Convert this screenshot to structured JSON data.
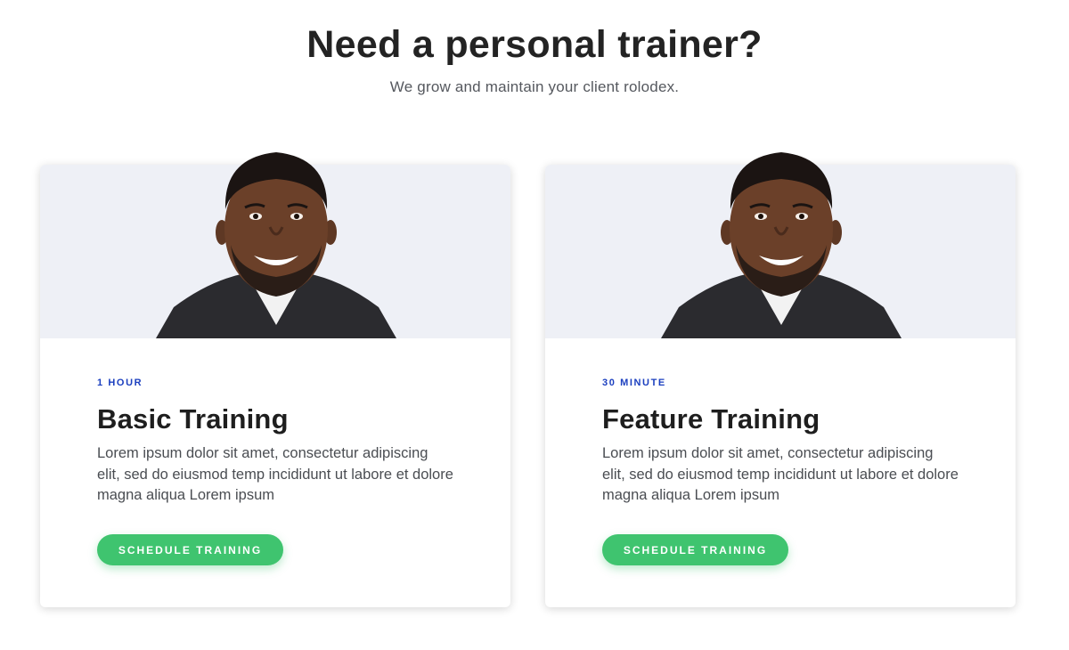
{
  "header": {
    "title": "Need a personal trainer?",
    "subtitle": "We grow and maintain your client rolodex."
  },
  "cards": [
    {
      "duration": "1 HOUR",
      "title": "Basic Training",
      "description": "Lorem ipsum dolor sit amet, consectetur adipiscing elit, sed do eiusmod temp incididunt ut labore et dolore magna aliqua Lorem ipsum",
      "button_label": "SCHEDULE TRAINING",
      "image_alt": "Smiling trainer portrait"
    },
    {
      "duration": "30 MINUTE",
      "title": "Feature Training",
      "description": "Lorem ipsum dolor sit amet, consectetur adipiscing elit, sed do eiusmod temp incididunt ut labore et dolore magna aliqua Lorem ipsum",
      "button_label": "SCHEDULE TRAINING",
      "image_alt": "Smiling trainer portrait"
    }
  ],
  "colors": {
    "accent_green": "#3fc46f",
    "duration_blue": "#1b3fbf",
    "media_background": "#eef0f6"
  }
}
